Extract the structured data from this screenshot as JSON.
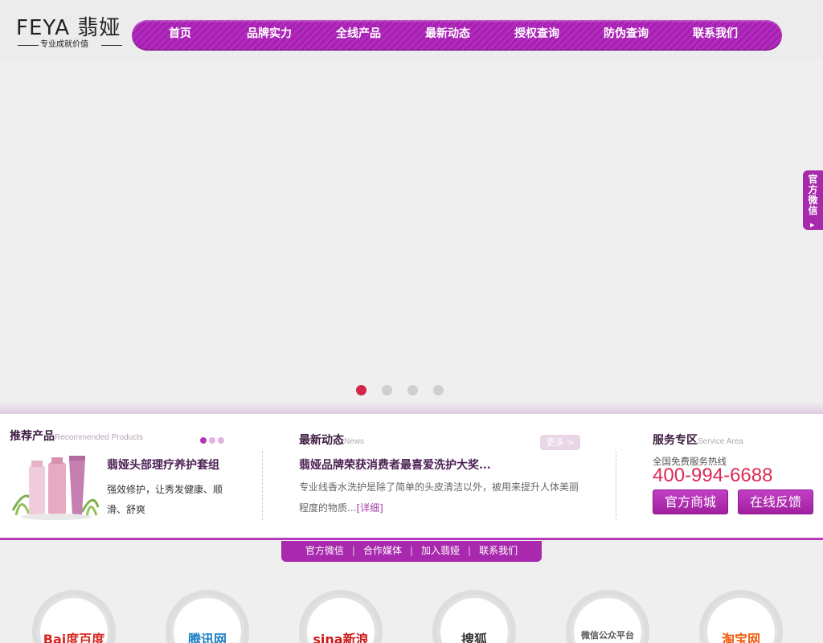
{
  "logo": {
    "brand": "FEYA 翡娅",
    "slogan": "专业成就价值"
  },
  "nav": {
    "items": [
      {
        "label": "首页"
      },
      {
        "label": "品牌实力"
      },
      {
        "label": "全线产品"
      },
      {
        "label": "最新动态"
      },
      {
        "label": "授权查询"
      },
      {
        "label": "防伪查询"
      },
      {
        "label": "联系我们"
      }
    ]
  },
  "banner": {
    "slide_count": 4,
    "active_slide": 1
  },
  "side_tab": {
    "label": "官方微信"
  },
  "recommend": {
    "title": "推荐产品",
    "subtitle": "Recommended Products",
    "product_name": "翡娅头部理疗养护套组",
    "product_desc": "强效修护，让秀发健康、顺滑、舒爽"
  },
  "news": {
    "title": "最新动态",
    "subtitle": "News",
    "more_label": "更多 >",
    "headline": "翡娅品牌荣获消费者最喜爱洗护大奖...",
    "summary": "专业线香水洗护是除了简单的头皮清洁以外，被用来提升人体美丽程度的物质...",
    "detail_label": "[详细]"
  },
  "service": {
    "title": "服务专区",
    "subtitle": "Service Area",
    "hotline_label": "全国免费服务热线",
    "hotline": "400-994-6688",
    "shop_label": "官方商城",
    "feedback_label": "在线反馈"
  },
  "footer_nav": {
    "items": [
      {
        "label": "官方微信"
      },
      {
        "label": "合作媒体"
      },
      {
        "label": "加入翡娅"
      },
      {
        "label": "联系我们"
      }
    ]
  },
  "partners": [
    {
      "name": "Bai度百度",
      "color": "#d7261e"
    },
    {
      "name": "腾讯网",
      "color": "#1a7fc4"
    },
    {
      "name": "sina新浪",
      "color": "#cc1a1a"
    },
    {
      "name": "搜狐",
      "color": "#333333"
    },
    {
      "name": "微信公众平台",
      "color": "#555555"
    },
    {
      "name": "淘宝网",
      "color": "#f25a0c"
    }
  ],
  "colors": {
    "accent": "#a829ad",
    "hotline": "#dc2a56",
    "dot_active": "#d4264a"
  }
}
